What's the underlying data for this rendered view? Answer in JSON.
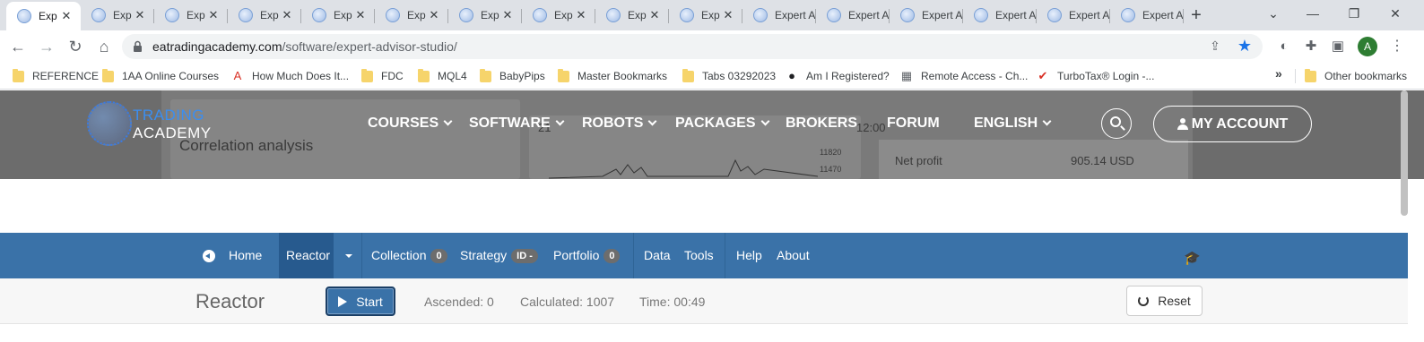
{
  "browser": {
    "tabs": [
      {
        "title": "Exp",
        "active": true
      },
      {
        "title": "Exp"
      },
      {
        "title": "Exp"
      },
      {
        "title": "Exp"
      },
      {
        "title": "Exp"
      },
      {
        "title": "Exp"
      },
      {
        "title": "Exp"
      },
      {
        "title": "Exp"
      },
      {
        "title": "Exp"
      },
      {
        "title": "Exp"
      },
      {
        "title": "Expert A"
      },
      {
        "title": "Expert A"
      },
      {
        "title": "Expert A"
      },
      {
        "title": "Expert A"
      },
      {
        "title": "Expert A"
      },
      {
        "title": "Expert A"
      }
    ],
    "tab_close_glyph": "✕",
    "new_tab_glyph": "+",
    "window_controls": {
      "dropdown": "⌄",
      "minimize": "—",
      "restore": "❐",
      "close": "✕"
    },
    "address": {
      "domain": "eatradingacademy.com",
      "path": "/software/expert-advisor-studio/"
    },
    "profile_initial": "A",
    "bookmarks": [
      {
        "label": "REFERENCE",
        "icon": "folder"
      },
      {
        "label": "1AA Online Courses",
        "icon": "folder"
      },
      {
        "label": "How Much Does It...",
        "icon": "site-a-icon"
      },
      {
        "label": "FDC",
        "icon": "folder"
      },
      {
        "label": "MQL4",
        "icon": "folder"
      },
      {
        "label": "BabyPips",
        "icon": "folder"
      },
      {
        "label": "Master Bookmarks",
        "icon": "folder"
      },
      {
        "label": "Tabs 03292023",
        "icon": "folder"
      },
      {
        "label": "Am I Registered?",
        "icon": "globe-icon"
      },
      {
        "label": "Remote Access - Ch...",
        "icon": "remote-icon"
      },
      {
        "label": "TurboTax® Login -...",
        "icon": "turbotax-icon"
      }
    ],
    "bookmarks_overflow": "»",
    "other_bookmarks": "Other bookmarks"
  },
  "site": {
    "logo_top": "TRADING",
    "logo_bottom": "ACADEMY",
    "nav": [
      {
        "label": "COURSES",
        "dropdown": true
      },
      {
        "label": "SOFTWARE",
        "dropdown": true
      },
      {
        "label": "ROBOTS",
        "dropdown": true
      },
      {
        "label": "PACKAGES",
        "dropdown": true
      },
      {
        "label": "BROKERS",
        "dropdown": false
      },
      {
        "label": "FORUM",
        "dropdown": false
      },
      {
        "label": "ENGLISH",
        "dropdown": true
      }
    ],
    "account_label": "MY ACCOUNT",
    "background_text": {
      "heading": "Correlation analysis",
      "chart_header": "21",
      "time": "12:00",
      "tick_1": "11820",
      "tick_2": "11470",
      "net_profit_label": "Net profit",
      "net_profit_value": "905.14 USD"
    }
  },
  "app": {
    "nav": {
      "home": "Home",
      "reactor": "Reactor",
      "collection": "Collection",
      "collection_count": "0",
      "strategy": "Strategy",
      "strategy_id": "ID -",
      "portfolio": "Portfolio",
      "portfolio_count": "0",
      "data": "Data",
      "tools": "Tools",
      "help": "Help",
      "about": "About"
    },
    "reactor": {
      "title": "Reactor",
      "start_label": "Start",
      "ascended": "Ascended: 0",
      "calculated": "Calculated: 1007",
      "time": "Time: 00:49",
      "reset_label": "Reset"
    }
  }
}
